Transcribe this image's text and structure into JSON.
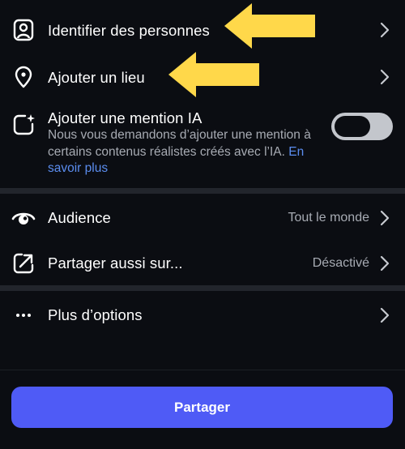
{
  "colors": {
    "background": "#0b0d12",
    "text": "#ffffff",
    "secondary_text": "#a7abb3",
    "link": "#5b8def",
    "annotation_arrow": "#ffd84a",
    "primary_button": "#4f5bf6",
    "toggle_off": "#c3c6cc"
  },
  "rows": {
    "tag_people": {
      "label": "Identifier des personnes",
      "icon": "person-tag-icon"
    },
    "add_location": {
      "label": "Ajouter un lieu",
      "icon": "location-pin-icon"
    },
    "ai_label": {
      "label": "Ajouter une mention IA",
      "icon": "ai-sparkle-icon",
      "description": "Nous vous demandons d’ajouter une mention à certains contenus réalistes créés avec l’IA.",
      "link": "En savoir plus",
      "toggle_on": false
    },
    "audience": {
      "label": "Audience",
      "value": "Tout le monde",
      "icon": "eye-icon"
    },
    "share_to": {
      "label": "Partager aussi sur...",
      "value": "Désactivé",
      "icon": "share-arrow-icon"
    },
    "more_options": {
      "label": "Plus d’options",
      "icon": "more-dots-icon"
    }
  },
  "share_button": {
    "label": "Partager"
  }
}
